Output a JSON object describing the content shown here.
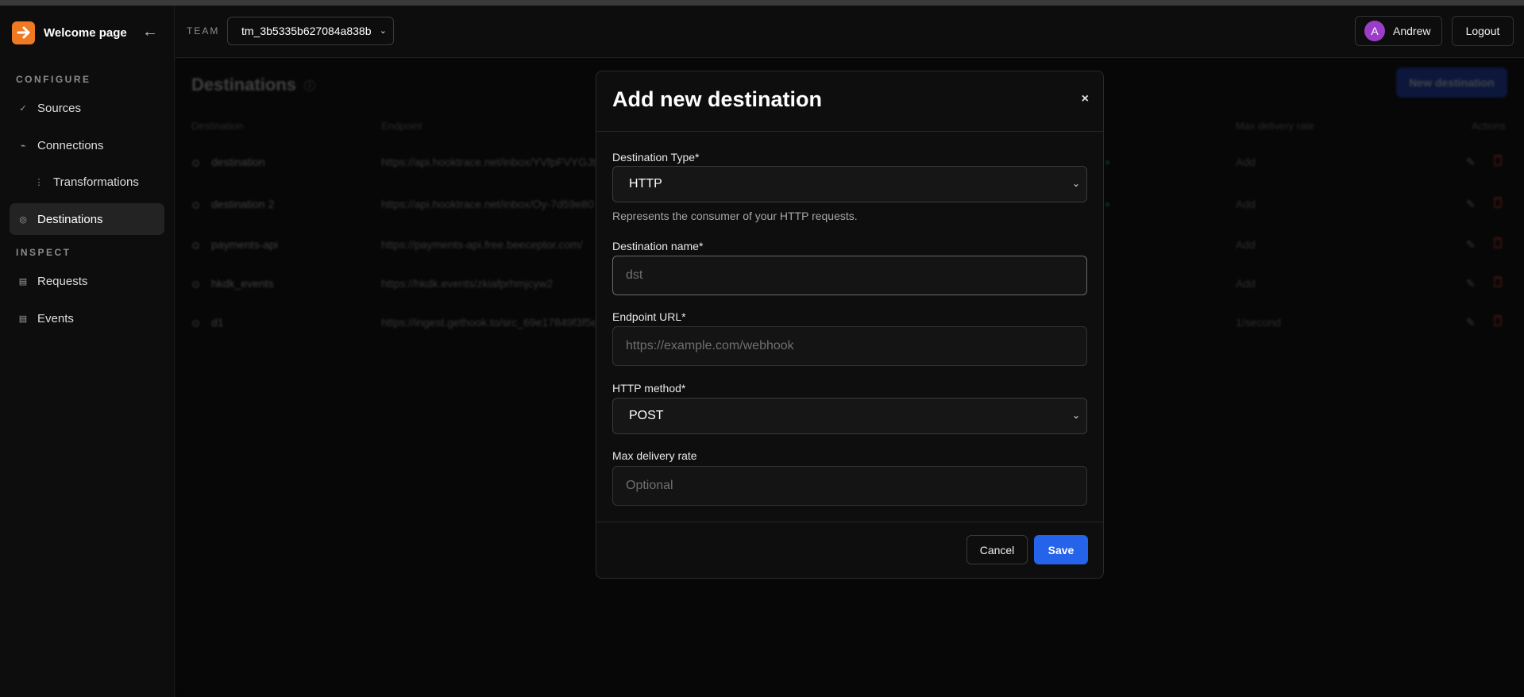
{
  "brand": {
    "title": "Welcome page"
  },
  "sidebar": {
    "configure_label": "CONFIGURE",
    "inspect_label": "INSPECT",
    "items": [
      {
        "label": "Sources",
        "icon": "check-icon"
      },
      {
        "label": "Connections",
        "icon": "connections-icon"
      },
      {
        "label": "Transformations",
        "icon": "transformations-icon"
      },
      {
        "label": "Destinations",
        "icon": "destinations-icon",
        "active": true
      },
      {
        "label": "Requests",
        "icon": "requests-icon"
      },
      {
        "label": "Events",
        "icon": "events-icon"
      }
    ]
  },
  "topbar": {
    "team_label": "TEAM",
    "team_value": "tm_3b5335b627084a838b",
    "user_initial": "A",
    "user_name": "Andrew",
    "logout_label": "Logout"
  },
  "page": {
    "title": "Destinations",
    "new_button": "New destination",
    "columns": {
      "destination": "Destination",
      "endpoint": "Endpoint",
      "max_delivery_rate": "Max delivery rate",
      "actions": "Actions"
    },
    "rows": [
      {
        "name": "destination",
        "endpoint": "https://api.hooktrace.net/inbox/YVfpFVYGJt",
        "rate": "Add"
      },
      {
        "name": "destination 2",
        "endpoint": "https://api.hooktrace.net/inbox/Oy-7d59e80",
        "rate": "Add"
      },
      {
        "name": "payments-api",
        "endpoint": "https://payments-api.free.beeceptor.com/",
        "rate": "Add"
      },
      {
        "name": "hkdk_events",
        "endpoint": "https://hkdk.events/zkiafprhmjcyw2",
        "rate": "Add"
      },
      {
        "name": "d1",
        "endpoint": "https://ingest.gethook.to/src_69e17849f3f5e",
        "rate": "1/second"
      }
    ]
  },
  "modal": {
    "title": "Add new destination",
    "close": "×",
    "type_label": "Destination Type*",
    "type_value": "HTTP",
    "type_help": "Represents the consumer of your HTTP requests.",
    "name_label": "Destination name*",
    "name_placeholder": "dst",
    "url_label": "Endpoint URL*",
    "url_placeholder": "https://example.com/webhook",
    "method_label": "HTTP method*",
    "method_value": "POST",
    "rate_label": "Max delivery rate",
    "rate_placeholder": "Optional",
    "cancel_label": "Cancel",
    "save_label": "Save"
  }
}
